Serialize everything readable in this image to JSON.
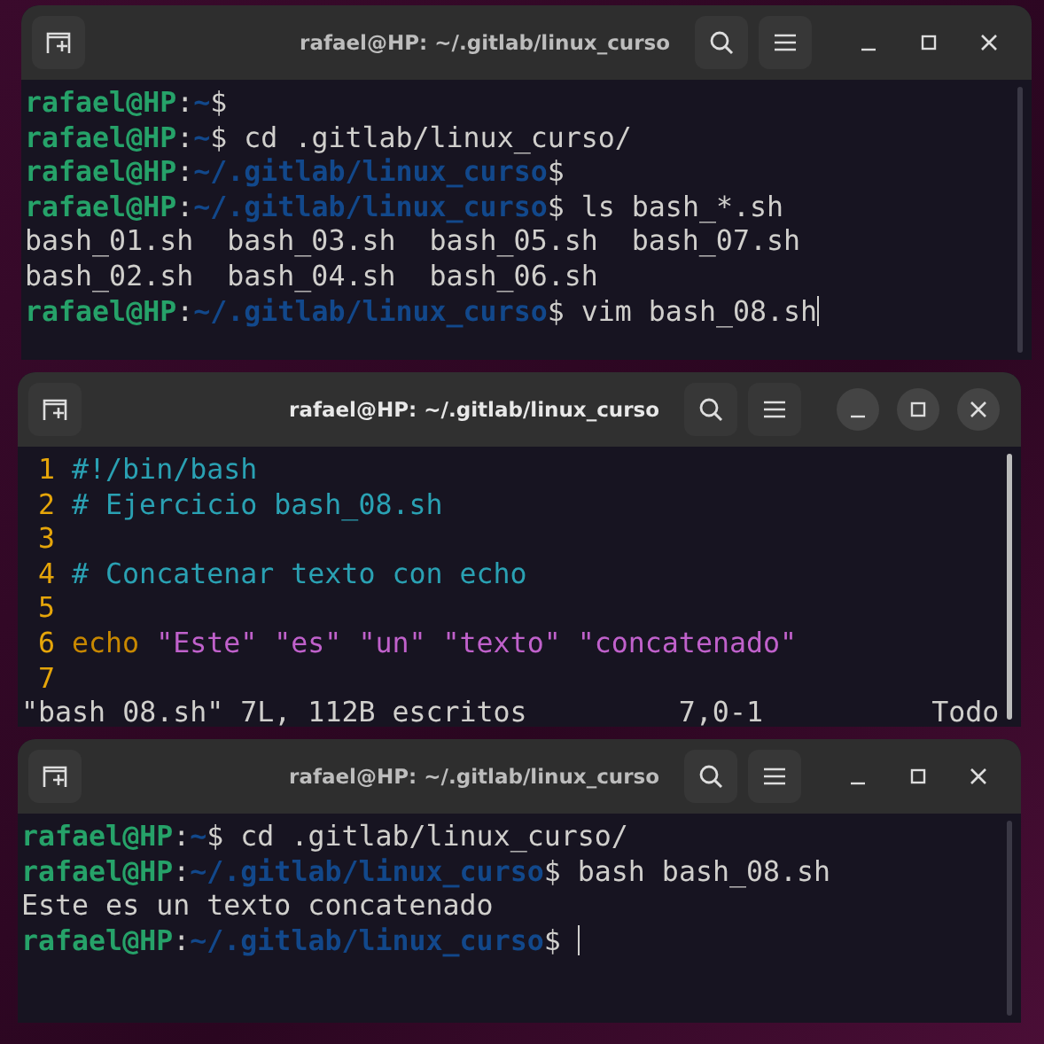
{
  "windows": [
    {
      "title": "rafael@HP: ~/.gitlab/linux_curso",
      "focused": false,
      "kind": "shell",
      "lines": [
        {
          "cursor": false,
          "segments": [
            {
              "kind": "user",
              "text": "rafael@HP"
            },
            {
              "kind": "plain",
              "text": ":"
            },
            {
              "kind": "path",
              "text": "~"
            },
            {
              "kind": "plain",
              "text": "$"
            }
          ]
        },
        {
          "cursor": false,
          "segments": [
            {
              "kind": "user",
              "text": "rafael@HP"
            },
            {
              "kind": "plain",
              "text": ":"
            },
            {
              "kind": "path",
              "text": "~"
            },
            {
              "kind": "plain",
              "text": "$ cd .gitlab/linux_curso/"
            }
          ]
        },
        {
          "cursor": false,
          "segments": [
            {
              "kind": "user",
              "text": "rafael@HP"
            },
            {
              "kind": "plain",
              "text": ":"
            },
            {
              "kind": "path",
              "text": "~/.gitlab/linux_curso"
            },
            {
              "kind": "plain",
              "text": "$"
            }
          ]
        },
        {
          "cursor": false,
          "segments": [
            {
              "kind": "user",
              "text": "rafael@HP"
            },
            {
              "kind": "plain",
              "text": ":"
            },
            {
              "kind": "path",
              "text": "~/.gitlab/linux_curso"
            },
            {
              "kind": "plain",
              "text": "$ ls bash_*.sh"
            }
          ]
        },
        {
          "cursor": false,
          "segments": [
            {
              "kind": "plain",
              "text": "bash_01.sh  bash_03.sh  bash_05.sh  bash_07.sh"
            }
          ]
        },
        {
          "cursor": false,
          "segments": [
            {
              "kind": "plain",
              "text": "bash_02.sh  bash_04.sh  bash_06.sh"
            }
          ]
        },
        {
          "cursor": true,
          "segments": [
            {
              "kind": "user",
              "text": "rafael@HP"
            },
            {
              "kind": "plain",
              "text": ":"
            },
            {
              "kind": "path",
              "text": "~/.gitlab/linux_curso"
            },
            {
              "kind": "plain",
              "text": "$ vim bash_08.sh"
            }
          ]
        }
      ]
    },
    {
      "title": "rafael@HP: ~/.gitlab/linux_curso",
      "focused": true,
      "kind": "vim",
      "lines": [
        {
          "number": "1",
          "segments": [
            {
              "kind": "comment",
              "text": "#!/bin/bash"
            }
          ]
        },
        {
          "number": "2",
          "segments": [
            {
              "kind": "comment",
              "text": "# Ejercicio bash_08.sh"
            }
          ]
        },
        {
          "number": "3"
        },
        {
          "number": "4",
          "segments": [
            {
              "kind": "comment",
              "text": "# Concatenar texto con echo"
            }
          ]
        },
        {
          "number": "5"
        },
        {
          "number": "6",
          "segments": [
            {
              "kind": "keyword",
              "text": "echo"
            },
            {
              "kind": "string",
              "text": " \"Este\""
            },
            {
              "kind": "string",
              "text": " \"es\""
            },
            {
              "kind": "string",
              "text": " \"un\""
            },
            {
              "kind": "string",
              "text": " \"texto\""
            },
            {
              "kind": "string",
              "text": " \"concatenado\""
            }
          ]
        },
        {
          "number": "7"
        }
      ],
      "status": {
        "message": "\"bash_08.sh\" 7L, 112B escritos",
        "position": "7,0-1",
        "scroll": "Todo"
      }
    },
    {
      "title": "rafael@HP: ~/.gitlab/linux_curso",
      "focused": false,
      "kind": "shell",
      "lines": [
        {
          "cursor": false,
          "segments": [
            {
              "kind": "user",
              "text": "rafael@HP"
            },
            {
              "kind": "plain",
              "text": ":"
            },
            {
              "kind": "path",
              "text": "~"
            },
            {
              "kind": "plain",
              "text": "$ cd .gitlab/linux_curso/"
            }
          ]
        },
        {
          "cursor": false,
          "segments": [
            {
              "kind": "user",
              "text": "rafael@HP"
            },
            {
              "kind": "plain",
              "text": ":"
            },
            {
              "kind": "path",
              "text": "~/.gitlab/linux_curso"
            },
            {
              "kind": "plain",
              "text": "$ bash bash_08.sh"
            }
          ]
        },
        {
          "cursor": false,
          "segments": [
            {
              "kind": "plain",
              "text": "Este es un texto concatenado"
            }
          ]
        },
        {
          "cursor": true,
          "segments": [
            {
              "kind": "user",
              "text": "rafael@HP"
            },
            {
              "kind": "plain",
              "text": ":"
            },
            {
              "kind": "path",
              "text": "~/.gitlab/linux_curso"
            },
            {
              "kind": "plain",
              "text": "$ "
            }
          ]
        }
      ]
    }
  ]
}
